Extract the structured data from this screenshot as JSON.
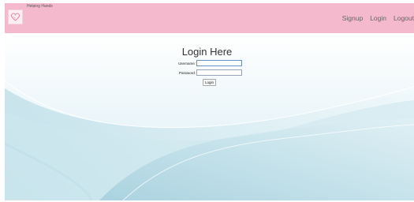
{
  "header": {
    "brand": "Helping Hands",
    "nav": [
      "Signup",
      "Login",
      "Logout"
    ]
  },
  "login": {
    "title": "Login Here",
    "username_label": "Username:",
    "username_value": "",
    "password_label": "Password:",
    "password_value": "",
    "button_label": "Login"
  },
  "colors": {
    "header_bg": "#f5b9cd",
    "nav_text": "#666666"
  },
  "icons": {
    "logo": "heart-logo-icon"
  }
}
